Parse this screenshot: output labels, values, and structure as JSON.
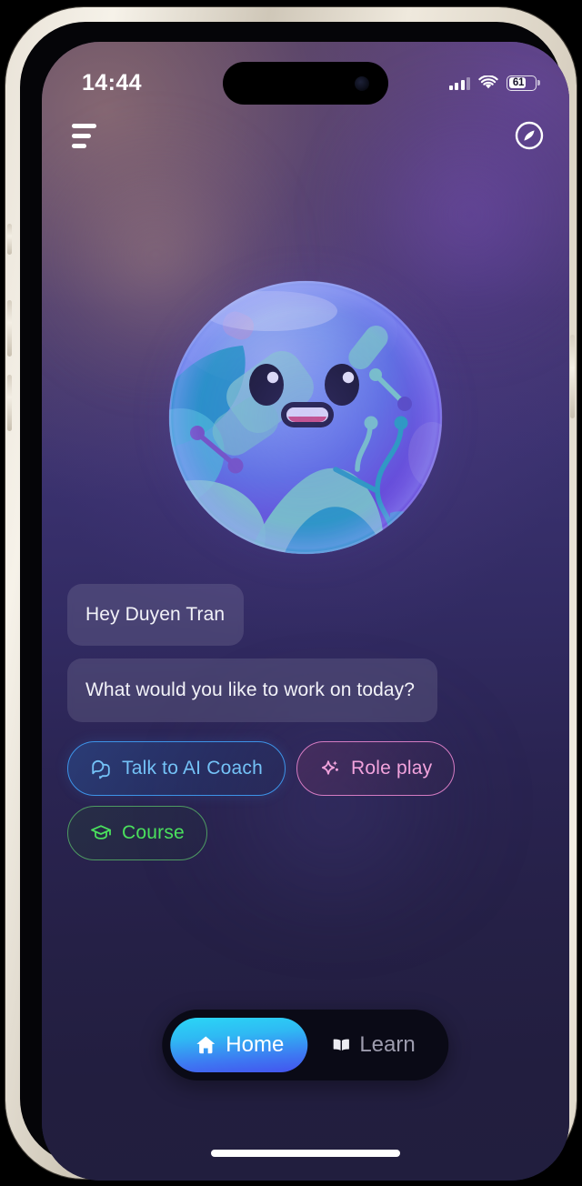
{
  "device": {
    "frame_color": "#e9e3d8",
    "screen_bg_top": "#503e5c",
    "screen_bg_bottom": "#211e3e"
  },
  "status_bar": {
    "time": "14:44",
    "cellular_icon": "signal-bars-icon",
    "wifi_icon": "wifi-icon",
    "battery_percent": "61",
    "battery_level": 61
  },
  "top_nav": {
    "menu_icon": "hamburger-menu-icon",
    "menu_label": "Menu",
    "compass_icon": "compass-icon",
    "compass_label": "Explore"
  },
  "mascot": {
    "name": "globe-mascot",
    "description": "Smiling globe character",
    "colors": {
      "sphere_light": "#7d9bf0",
      "sphere_dark": "#6a3fd6",
      "land_teal": "#8fdad2",
      "land_blue": "#27a3cf",
      "mouth": "#e8506f"
    }
  },
  "chat": {
    "bubbles": [
      {
        "id": "greeting",
        "text": "Hey Duyen Tran"
      },
      {
        "id": "prompt",
        "text": "What would you like to work on today?"
      }
    ]
  },
  "chips": [
    {
      "id": "talk-to-ai-coach",
      "label": "Talk to AI Coach",
      "icon": "chat-bubbles-icon",
      "color": "#74c2f7",
      "border": "#3d93e8"
    },
    {
      "id": "role-play",
      "label": "Role play",
      "icon": "sparkle-icon",
      "color": "#f2a3dd",
      "border": "#d47bc2"
    },
    {
      "id": "course",
      "label": "Course",
      "icon": "graduation-cap-icon",
      "color": "#4ae05d",
      "border": "#4e9a62"
    }
  ],
  "bottom_nav": {
    "items": [
      {
        "id": "home",
        "label": "Home",
        "icon": "house-icon",
        "active": true,
        "accent_start": "#2ad7f6",
        "accent_end": "#4452ee"
      },
      {
        "id": "learn",
        "label": "Learn",
        "icon": "open-book-icon",
        "active": false,
        "color": "#9d9cae"
      }
    ]
  },
  "home_indicator": {
    "label": "Home indicator"
  }
}
